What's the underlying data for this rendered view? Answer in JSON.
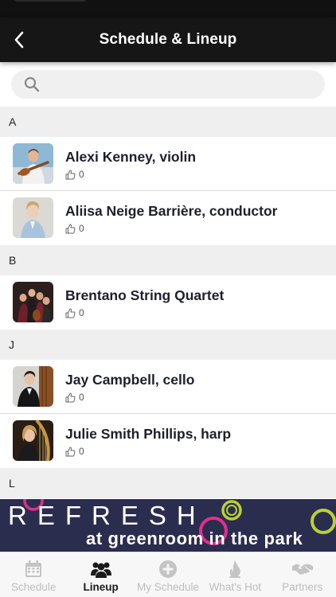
{
  "header": {
    "title": "Schedule & Lineup",
    "back_icon": "chevron-left-icon"
  },
  "search": {
    "placeholder": "",
    "icon": "search-icon"
  },
  "sections": [
    {
      "letter": "A",
      "items": [
        {
          "name": "Alexi Kenney, violin",
          "likes": "0"
        },
        {
          "name": "Aliisa Neige Barrière, conductor",
          "likes": "0"
        }
      ]
    },
    {
      "letter": "B",
      "items": [
        {
          "name": "Brentano String Quartet",
          "likes": "0"
        }
      ]
    },
    {
      "letter": "J",
      "items": [
        {
          "name": "Jay Campbell, cello",
          "likes": "0"
        },
        {
          "name": "Julie Smith Phillips, harp",
          "likes": "0"
        }
      ]
    },
    {
      "letter": "L",
      "items": []
    }
  ],
  "banner": {
    "title": "REFRESH",
    "tagline": "at greenroom in the park"
  },
  "tabs": [
    {
      "label": "Schedule",
      "icon": "calendar-icon",
      "active": false
    },
    {
      "label": "Lineup",
      "icon": "people-icon",
      "active": true
    },
    {
      "label": "My Schedule",
      "icon": "plus-circle-icon",
      "active": false
    },
    {
      "label": "What's Hot",
      "icon": "flame-icon",
      "active": false
    },
    {
      "label": "Partners",
      "icon": "handshake-icon",
      "active": false
    }
  ],
  "colors": {
    "header_bg": "#161616",
    "section_bg": "#efeff0",
    "tab_inactive": "#bdbdbd",
    "tab_active": "#1a1a1a",
    "banner_bg": "#2b2d4f"
  }
}
